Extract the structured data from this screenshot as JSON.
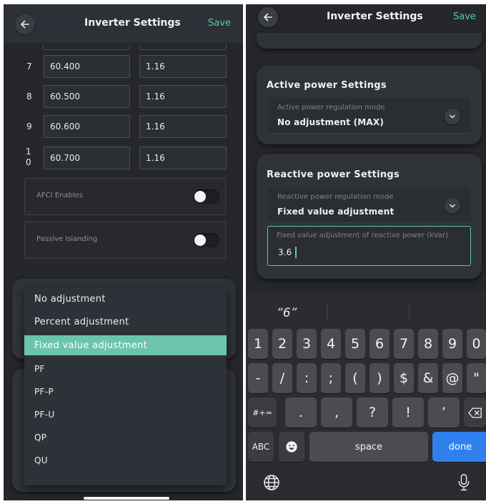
{
  "left": {
    "header": {
      "title": "Inverter Settings",
      "save_label": "Save"
    },
    "rows": [
      {
        "num": "7",
        "value": "60.400",
        "ratio": "1.16"
      },
      {
        "num": "8",
        "value": "60.500",
        "ratio": "1.16"
      },
      {
        "num": "9",
        "value": "60.600",
        "ratio": "1.16"
      },
      {
        "num": "1\n0",
        "value": "60.700",
        "ratio": "1.16"
      }
    ],
    "afci_label": "AFCI Enables",
    "afci_on": false,
    "islanding_label": "Passive Islanding",
    "islanding_on": false,
    "dropdown_options": [
      "No adjustment",
      "Percent adjustment",
      "Fixed value adjustment",
      "PF",
      "PF-P",
      "PF-U",
      "QP",
      "QU"
    ],
    "dropdown_selected": "Fixed value adjustment"
  },
  "right": {
    "header": {
      "title": "Inverter Settings",
      "save_label": "Save"
    },
    "active": {
      "title": "Active power Settings",
      "mode_label": "Active power regulation mode",
      "mode_value": "No adjustment (MAX)"
    },
    "reactive": {
      "title": "Reactive power Settings",
      "mode_label": "Reactive power regulation mode",
      "mode_value": "Fixed value adjustment",
      "fixed_label": "Fixed value adjustment of reactive power (kVar)",
      "fixed_value": "3.6"
    },
    "keyboard": {
      "suggestion": "“6”",
      "row1": [
        "1",
        "2",
        "3",
        "4",
        "5",
        "6",
        "7",
        "8",
        "9",
        "0"
      ],
      "row2": [
        "-",
        "/",
        ":",
        ";",
        "(",
        ")",
        "$",
        "&",
        "@",
        "\""
      ],
      "row3_mode": "#+=",
      "row3": [
        ".",
        ",",
        "?",
        "!",
        "’"
      ],
      "abc_label": "ABC",
      "space_label": "space",
      "done_label": "done"
    }
  },
  "colors": {
    "accent": "#5cc8a8",
    "selected_bg": "#6cc4ad",
    "done_blue": "#2f80ed",
    "panel_bg": "#25272c"
  },
  "icons": {
    "back": "arrow-left-icon",
    "chevron": "chevron-down-icon",
    "delete": "backspace-icon",
    "emoji": "emoji-icon",
    "globe": "globe-icon",
    "mic": "microphone-icon"
  }
}
